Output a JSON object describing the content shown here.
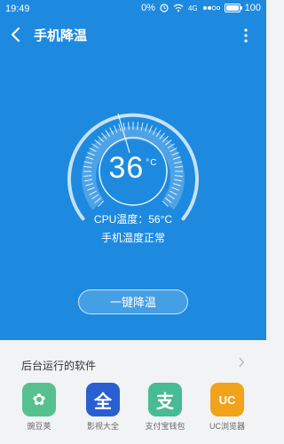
{
  "status_bar": {
    "time": "19:49",
    "data_speed": "0%",
    "network": "4G",
    "battery": "100"
  },
  "app_bar": {
    "title": "手机降温"
  },
  "gauge": {
    "temperature": "36",
    "unit": "°C",
    "cpu_label": "CPU温度：56°C",
    "status": "手机温度正常"
  },
  "action": {
    "cool_button": "一键降温"
  },
  "background_apps": {
    "title": "后台运行的软件",
    "apps": [
      {
        "label": "豌豆荚",
        "icon": "wandoujia-icon",
        "color": "#57c08f",
        "glyph": "✿"
      },
      {
        "label": "影视大全",
        "icon": "video-icon",
        "color": "#2a5fd1",
        "glyph": "全"
      },
      {
        "label": "支付宝钱包",
        "icon": "alipay-icon",
        "color": "#47bb93",
        "glyph": "支"
      },
      {
        "label": "UC浏览器",
        "icon": "uc-icon",
        "color": "#f1a31b",
        "glyph": "UC"
      }
    ]
  },
  "colors": {
    "primary": "#1d8ae0",
    "background": "#f1f3f5"
  }
}
